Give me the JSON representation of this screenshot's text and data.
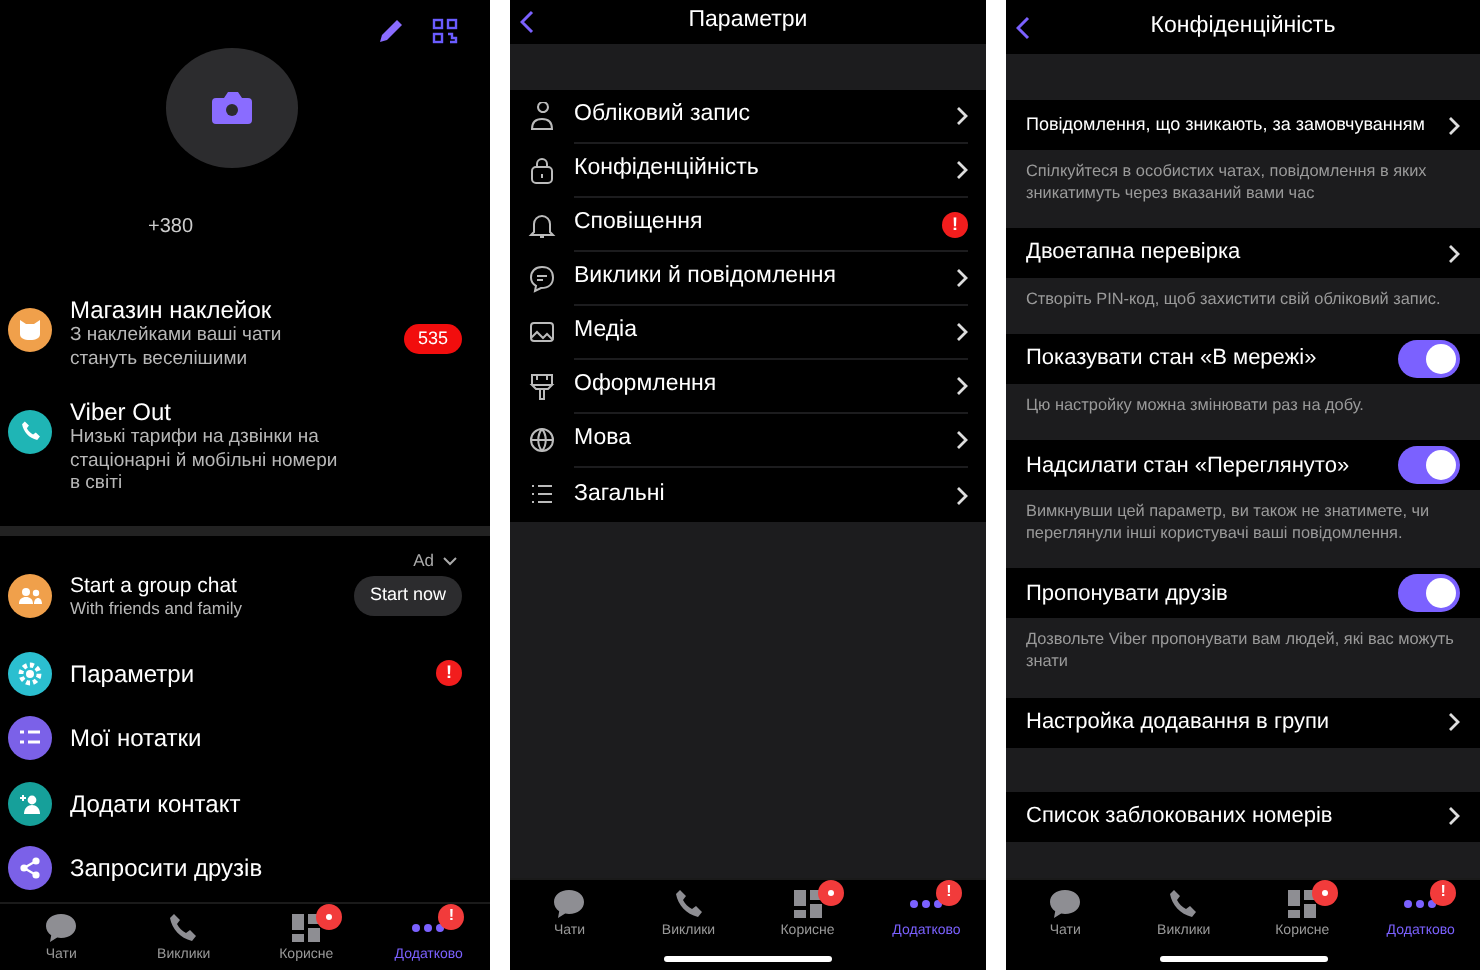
{
  "more_screen": {
    "phone": "+380",
    "promos": [
      {
        "kind": "stickers",
        "title": "Магазин наклейок",
        "subtitle": "З наклейками ваші чати стануть веселішими",
        "badge": "535",
        "color": "#f0a04b"
      },
      {
        "kind": "viber_out",
        "title": "Viber Out",
        "subtitle": "Низькі тарифи на дзвінки на стаціонарні й мобільні номери в світі",
        "color": "#1fb5b5"
      }
    ],
    "ad": {
      "label": "Ad",
      "title": "Start a group chat",
      "subtitle": "With friends and family",
      "button": "Start now"
    },
    "menu": [
      {
        "kind": "settings",
        "label": "Параметри",
        "alert": "!",
        "color": "#2bbfd0"
      },
      {
        "kind": "notes",
        "label": "Мої нотатки",
        "color": "#7b61e8"
      },
      {
        "kind": "contact",
        "label": "Додати контакт",
        "color": "#16a09a"
      },
      {
        "kind": "share",
        "label": "Запросити друзів",
        "color": "#7b61e8"
      }
    ],
    "tab_bar": [
      {
        "kind": "chats",
        "label": "Чати",
        "selected": false
      },
      {
        "kind": "calls",
        "label": "Виклики",
        "selected": false
      },
      {
        "kind": "explore",
        "label": "Корисне",
        "selected": false,
        "badge": {
          "kind": "dot"
        }
      },
      {
        "kind": "more",
        "label": "Додатково",
        "selected": true,
        "badge": {
          "kind": "alert",
          "text": "!"
        }
      }
    ]
  },
  "settings_screen": {
    "title": "Параметри",
    "items": [
      {
        "kind": "account",
        "label": "Обліковий запис"
      },
      {
        "kind": "privacy",
        "label": "Конфіденційність"
      },
      {
        "kind": "notifications",
        "label": "Сповіщення",
        "alert": "!"
      },
      {
        "kind": "calls",
        "label": "Виклики й повідомлення"
      },
      {
        "kind": "media",
        "label": "Медіа"
      },
      {
        "kind": "appearance",
        "label": "Оформлення"
      },
      {
        "kind": "language",
        "label": "Мова"
      },
      {
        "kind": "general",
        "label": "Загальні"
      }
    ],
    "tab_bar": [
      {
        "kind": "chats",
        "label": "Чати",
        "selected": false
      },
      {
        "kind": "calls",
        "label": "Виклики",
        "selected": false
      },
      {
        "kind": "explore",
        "label": "Корисне",
        "selected": false,
        "badge": {
          "kind": "dot"
        }
      },
      {
        "kind": "more",
        "label": "Додатково",
        "selected": true,
        "badge": {
          "kind": "alert",
          "text": "!"
        }
      }
    ]
  },
  "privacy_screen": {
    "title": "Конфіденційність",
    "sections": [
      {
        "kind": "link",
        "label": "Повідомлення, що зникають, за замовчуванням",
        "note": "Спілкуйтеся в особистих чатах, повідомлення в яких зникатимуть через вказаний вами час"
      },
      {
        "kind": "link",
        "label": "Двоетапна перевірка",
        "note": "Створіть PIN-код, щоб захистити свій обліковий запис."
      },
      {
        "kind": "toggle",
        "label": "Показувати стан «В мережі»",
        "on": true,
        "note": "Цю настройку можна змінювати раз на добу."
      },
      {
        "kind": "toggle",
        "label": "Надсилати стан «Переглянуто»",
        "on": true,
        "note": "Вимкнувши цей параметр, ви також не знатимете, чи переглянули інші користувачі ваші повідомлення."
      },
      {
        "kind": "toggle",
        "label": "Пропонувати друзів",
        "on": true,
        "note": "Дозвольте Viber пропонувати вам людей, які вас можуть знати"
      },
      {
        "kind": "link",
        "label": "Настройка додавання в групи"
      },
      {
        "kind": "link",
        "label": "Список заблокованих номерів"
      }
    ],
    "tab_bar": [
      {
        "kind": "chats",
        "label": "Чати",
        "selected": false
      },
      {
        "kind": "calls",
        "label": "Виклики",
        "selected": false
      },
      {
        "kind": "explore",
        "label": "Корисне",
        "selected": false,
        "badge": {
          "kind": "dot"
        }
      },
      {
        "kind": "more",
        "label": "Додатково",
        "selected": true,
        "badge": {
          "kind": "alert",
          "text": "!"
        }
      }
    ]
  }
}
